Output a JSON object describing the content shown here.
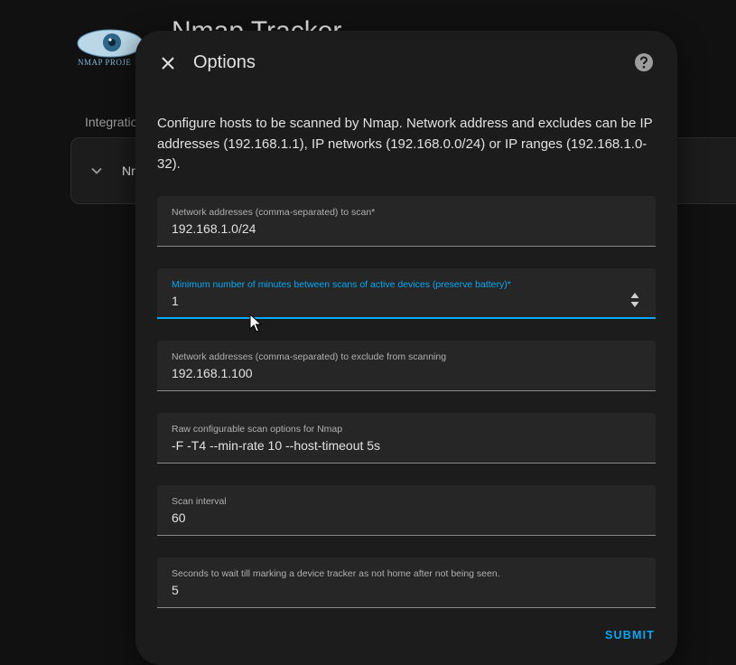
{
  "background": {
    "logo_text": "NMAP PROJE",
    "title": "Nmap Tracker",
    "breadcrumb": "Integration",
    "card_text": "Nr"
  },
  "dialog": {
    "title": "Options",
    "description": "Configure hosts to be scanned by Nmap. Network address and excludes can be IP addresses (192.168.1.1), IP networks (192.168.0.0/24) or IP ranges (192.168.1.0-32).",
    "fields": [
      {
        "label": "Network addresses (comma-separated) to scan*",
        "value": "192.168.1.0/24"
      },
      {
        "label": "Minimum number of minutes between scans of active devices (preserve battery)*",
        "value": "1"
      },
      {
        "label": "Network addresses (comma-separated) to exclude from scanning",
        "value": "192.168.1.100"
      },
      {
        "label": "Raw configurable scan options for Nmap",
        "value": "-F -T4 --min-rate 10 --host-timeout 5s"
      },
      {
        "label": "Scan interval",
        "value": "60"
      },
      {
        "label": "Seconds to wait till marking a device tracker as not home after not being seen.",
        "value": "5"
      }
    ],
    "submit_label": "SUBMIT"
  },
  "colors": {
    "accent": "#03a9f4",
    "surface": "#1c1c1c",
    "field": "#262626"
  },
  "icons": {
    "close": "close-icon",
    "help": "help-circle-icon",
    "spinner": "number-spinner-icon",
    "chevron": "chevron-down-icon"
  }
}
